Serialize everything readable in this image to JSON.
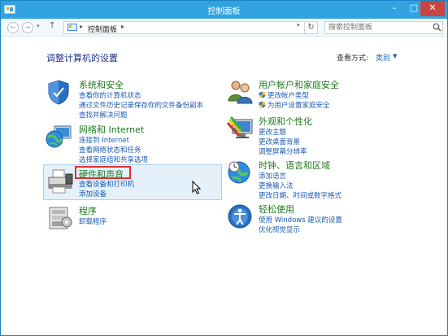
{
  "window": {
    "title": "控制面板",
    "controls": {
      "minimize": "–",
      "maximize": "□",
      "close": "✕"
    }
  },
  "addressbar": {
    "back": "←",
    "forward": "→",
    "up": "↑",
    "separator": "▸",
    "breadcrumb": "控制面板",
    "refresh": "↻",
    "search_placeholder": "搜索控制面板"
  },
  "content": {
    "title": "调整计算机的设置",
    "view_by_label": "查看方式:",
    "view_by_value": "类别",
    "dropdown_arrow": "▼"
  },
  "categories": [
    {
      "title": "系统和安全",
      "links": [
        "查看你的计算机状态",
        "通过文件历史记录保存你的文件备份副本",
        "查找并解决问题"
      ]
    },
    {
      "title": "网络和 Internet",
      "links": [
        "连接到 Internet",
        "查看网络状态和任务",
        "选择家庭组和共享选项"
      ]
    },
    {
      "title": "硬件和声音",
      "links": [
        "查看设备和打印机",
        "添加设备"
      ]
    },
    {
      "title": "程序",
      "links": [
        "卸载程序"
      ]
    },
    {
      "title": "用户帐户和家庭安全",
      "links": [
        "更改帐户类型",
        "为用户设置家庭安全"
      ]
    },
    {
      "title": "外观和个性化",
      "links": [
        "更改主题",
        "更改桌面背景",
        "调整屏幕分辨率"
      ]
    },
    {
      "title": "时钟、语言和区域",
      "links": [
        "添加语言",
        "更换输入法",
        "更改日期、时间或数字格式"
      ]
    },
    {
      "title": "轻松使用",
      "links": [
        "使用 Windows 建议的设置",
        "优化视觉显示"
      ]
    }
  ],
  "colors": {
    "titlebar": "#31a3e0",
    "close_button": "#c7463f",
    "category_title": "#1e7a1e",
    "link": "#1c5bb0",
    "highlight": "#e4f1fb",
    "annotation_red": "#e03030"
  }
}
